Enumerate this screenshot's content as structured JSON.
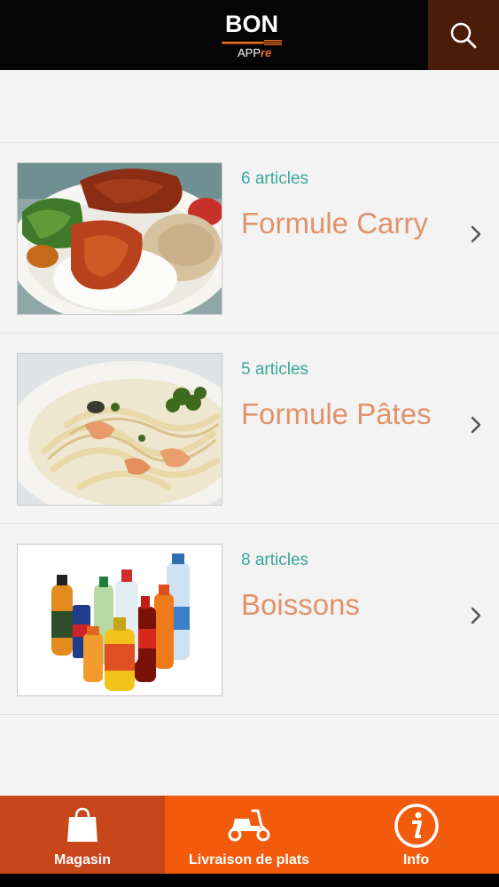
{
  "header": {
    "logo_main": "BON",
    "logo_sub_prefix": "APP",
    "logo_sub_accent": "re",
    "search_icon": "search-icon",
    "colors": {
      "bar": "#050505",
      "search_bg": "#4a1d0b",
      "accent": "#f36f1e"
    }
  },
  "categories": [
    {
      "count": "6 articles",
      "title": "Formule Carry",
      "image": "curry-plate-photo"
    },
    {
      "count": "5 articles",
      "title": "Formule Pâtes",
      "image": "pasta-plate-photo"
    },
    {
      "count": "8 articles",
      "title": "Boissons",
      "image": "drinks-bottles-photo"
    }
  ],
  "tabs": [
    {
      "label": "Magasin",
      "icon": "shopping-bag-icon",
      "active": true
    },
    {
      "label": "Livraison de plats",
      "icon": "scooter-icon",
      "active": false
    },
    {
      "label": "Info",
      "icon": "info-icon",
      "active": false
    }
  ],
  "colors": {
    "count_text": "#3aa89c",
    "title_text": "#e0936a",
    "tabbar": "#f25b0c",
    "tab_active": "#c8461a"
  }
}
